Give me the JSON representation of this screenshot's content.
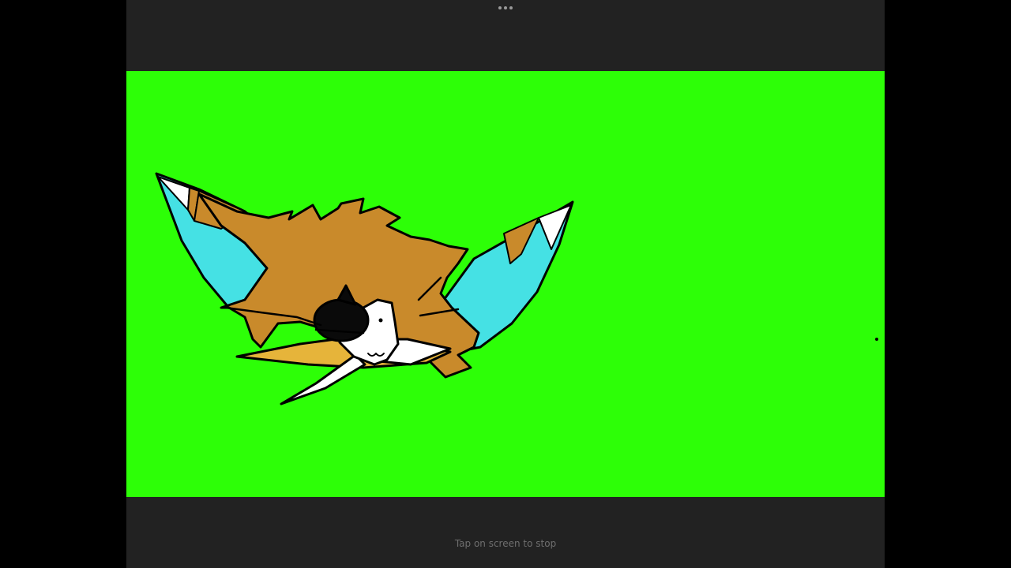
{
  "player": {
    "stop_hint": "Tap on screen to stop",
    "more_icon": "more-horizontal-icon"
  },
  "canvas": {
    "background_color": "#2dff07",
    "drawing": "winged-creature-doodle"
  },
  "colors": {
    "chrome": "#222222",
    "letterbox": "#000000",
    "wing_blue": "#45e1e4",
    "fur_brown": "#c98a2b",
    "accent_yellow": "#e6b43a"
  }
}
